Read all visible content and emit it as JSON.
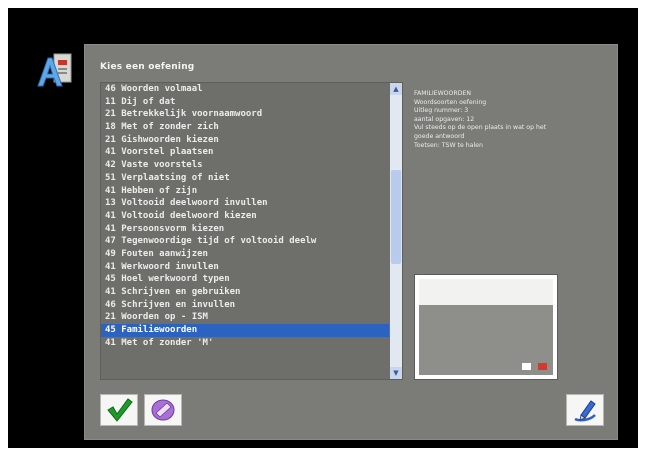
{
  "dialog": {
    "title": "Kies een oefening"
  },
  "exercise_list": {
    "items": [
      "46 Woorden volmaal",
      "11 Dij of dat",
      "21 Betrekkelijk voornaamwoord",
      "18 Met of zonder zich",
      "21 Gishwoorden kiezen",
      "41 Voorstel plaatsen",
      "42 Vaste voorstels",
      "51 Verplaatsing of niet",
      "41 Hebben of zijn",
      "13 Voltooid deelwoord invullen",
      "41 Voltooid deelwoord kiezen",
      "41 Persoonsvorm kiezen",
      "47 Tegenwoordige tijd of voltooid deelw",
      "49 Fouten aanwijzen",
      "41 Werkwoord invullen",
      "45 Hoel werkwoord typen",
      "41 Schrijven en gebruiken",
      "46 Schrijven en invullen",
      "21 Woorden op - ISM",
      "45 Familiewoorden",
      "41 Met of zonder 'M'"
    ],
    "selected_index": 19,
    "scroll_position": 0.42
  },
  "info": {
    "lines": [
      "FAMILIEWOORDEN",
      "Woordsoorten oefening",
      "Uitleg nummer: 3",
      "aantal opgaven: 12",
      "Vul steeds op de open plaats in wat op het",
      "goede antwoord",
      "Toetsen: TSW te halen"
    ]
  },
  "icons": {
    "app_logo": "app-logo-icon",
    "ok": "checkmark-icon",
    "erase": "eraser-icon",
    "help": "help-pen-icon"
  },
  "colors": {
    "dialog_bg": "#7b7b77",
    "selection": "#2c62c0",
    "check_green": "#1e9a2a"
  }
}
